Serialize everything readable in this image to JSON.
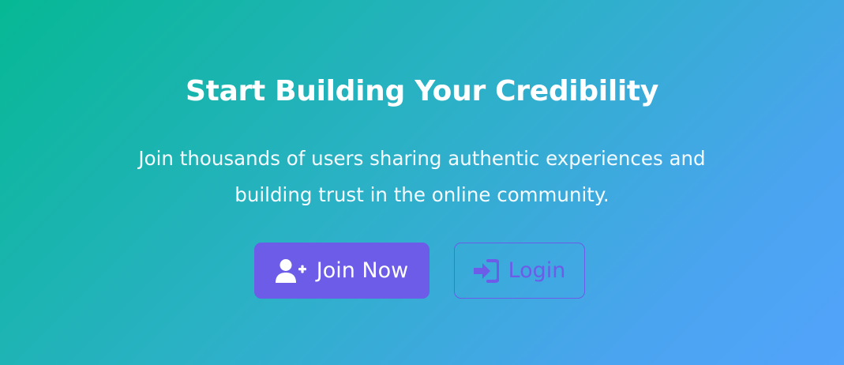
{
  "cta": {
    "title": "Start Building Your Credibility",
    "subtitle": "Join thousands of users sharing authentic experiences and building trust in the online community.",
    "buttons": {
      "join": {
        "label": "Join Now",
        "icon": "user-plus-icon"
      },
      "login": {
        "label": "Login",
        "icon": "sign-in-icon"
      }
    }
  },
  "colors": {
    "gradient_start": "#06b894",
    "gradient_end": "#52a3fb",
    "primary": "#6c5ce7",
    "text": "#ffffff"
  }
}
